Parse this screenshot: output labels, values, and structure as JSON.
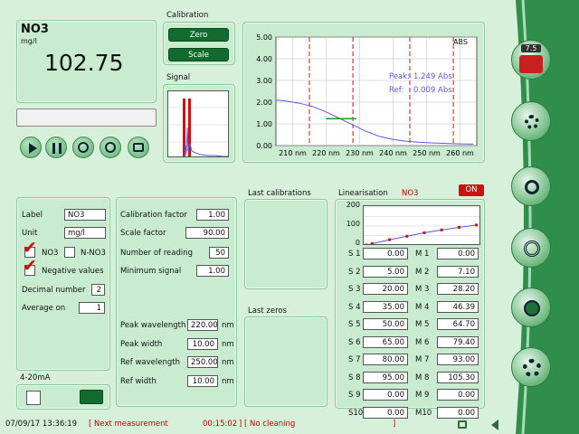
{
  "measurement": {
    "name": "NO3",
    "unit": "mg/l",
    "value": "102.75"
  },
  "calibration": {
    "title": "Calibration",
    "zero_label": "Zero",
    "scale_label": "Scale"
  },
  "signal": {
    "title": "Signal"
  },
  "spectrum": {
    "abs_label": "ABS",
    "peak_label": "Peak:",
    "peak_value": "1.249 Abs",
    "ref_label": "Ref:",
    "ref_value": "0.009 Abs"
  },
  "chart_data": [
    {
      "type": "line",
      "title": "",
      "xlabel": "",
      "ylabel": "",
      "xlim": [
        205,
        265
      ],
      "ylim": [
        0,
        5
      ],
      "x_ticks": [
        210,
        220,
        230,
        240,
        250,
        260
      ],
      "x_tick_labels": [
        "210 nm",
        "220 nm",
        "230 nm",
        "240 nm",
        "250 nm",
        "260 nm"
      ],
      "y_ticks": [
        0,
        1,
        2,
        3,
        4,
        5
      ],
      "y_tick_labels": [
        "0.00",
        "1.00",
        "2.00",
        "3.00",
        "4.00",
        "5.00"
      ],
      "grid": true,
      "series": [
        {
          "x": [
            205,
            208,
            212,
            216,
            220,
            224,
            228,
            232,
            236,
            240,
            244,
            248,
            252,
            256,
            260,
            264
          ],
          "y": [
            2.1,
            2.05,
            1.95,
            1.8,
            1.55,
            1.25,
            0.95,
            0.65,
            0.42,
            0.28,
            0.2,
            0.15,
            0.12,
            0.1,
            0.08,
            0.07
          ]
        }
      ],
      "vertical_markers": [
        215,
        228,
        245,
        258
      ],
      "segment": {
        "x": [
          220,
          229
        ],
        "y": 1.24
      }
    },
    {
      "type": "line",
      "title": "",
      "ylim": [
        0,
        200
      ],
      "y_ticks": [
        0,
        100,
        200
      ],
      "y_tick_labels": [
        "0",
        "100",
        "200"
      ],
      "series": [
        {
          "x": [
            0,
            5,
            20,
            35,
            50,
            65,
            80,
            95
          ],
          "y": [
            0,
            7.1,
            28.2,
            46.39,
            64.7,
            79.4,
            93.0,
            105.3
          ]
        }
      ]
    }
  ],
  "controls": {
    "play": "play-icon",
    "pause": "pause-icon"
  },
  "params": {
    "label_label": "Label",
    "label_value": "NO3",
    "unit_label": "Unit",
    "unit_value": "mg/l",
    "no3_label": "NO3",
    "nno3_label": "N-NO3",
    "negative_label": "Negative values",
    "decimal_label": "Decimal number",
    "decimal_value": "2",
    "average_label": "Average on",
    "average_value": "1"
  },
  "analog": {
    "title": "4-20mA"
  },
  "calib_params": {
    "cal_factor_label": "Calibration factor",
    "cal_factor_value": "1.00",
    "scale_factor_label": "Scale factor",
    "scale_factor_value": "90.00",
    "num_reading_label": "Number of reading",
    "num_reading_value": "50",
    "min_signal_label": "Minimum signal",
    "min_signal_value": "1.00",
    "peak_wl_label": "Peak wavelength",
    "peak_wl_value": "220.00",
    "peak_wl_unit": "nm",
    "peak_width_label": "Peak width",
    "peak_width_value": "10.00",
    "peak_width_unit": "nm",
    "ref_wl_label": "Ref wavelength",
    "ref_wl_value": "250.00",
    "ref_wl_unit": "nm",
    "ref_width_label": "Ref width",
    "ref_width_value": "10.00",
    "ref_width_unit": "nm"
  },
  "history": {
    "last_calibrations": "Last calibrations",
    "last_zeros": "Last zeros"
  },
  "linearisation": {
    "title": "Linearisation",
    "param": "NO3",
    "toggle": "ON",
    "rows": [
      {
        "s": "S 1",
        "sv": "0.00",
        "m": "M 1",
        "mv": "0.00"
      },
      {
        "s": "S 2",
        "sv": "5.00",
        "m": "M 2",
        "mv": "7.10"
      },
      {
        "s": "S 3",
        "sv": "20.00",
        "m": "M 3",
        "mv": "28.20"
      },
      {
        "s": "S 4",
        "sv": "35.00",
        "m": "M 4",
        "mv": "46.39"
      },
      {
        "s": "S 5",
        "sv": "50.00",
        "m": "M 5",
        "mv": "64.70"
      },
      {
        "s": "S 6",
        "sv": "65.00",
        "m": "M 6",
        "mv": "79.40"
      },
      {
        "s": "S 7",
        "sv": "80.00",
        "m": "M 7",
        "mv": "93.00"
      },
      {
        "s": "S 8",
        "sv": "95.00",
        "m": "M 8",
        "mv": "105.30"
      },
      {
        "s": "S 9",
        "sv": "0.00",
        "m": "M 9",
        "mv": "0.00"
      },
      {
        "s": "S10",
        "sv": "0.00",
        "m": "M10",
        "mv": "0.00"
      }
    ]
  },
  "sidebar": {
    "badge": "7.5"
  },
  "status": {
    "datetime": "07/09/17  13:36:19",
    "next": "[  Next measurement",
    "countdown": "00:15:02",
    "cleaning": "]   [  No cleaning",
    "close": "]"
  },
  "colors": {
    "accent": "#116b2e",
    "panel": "#c9ecd0",
    "marker": "#d01010",
    "curve": "#5a5adc"
  }
}
